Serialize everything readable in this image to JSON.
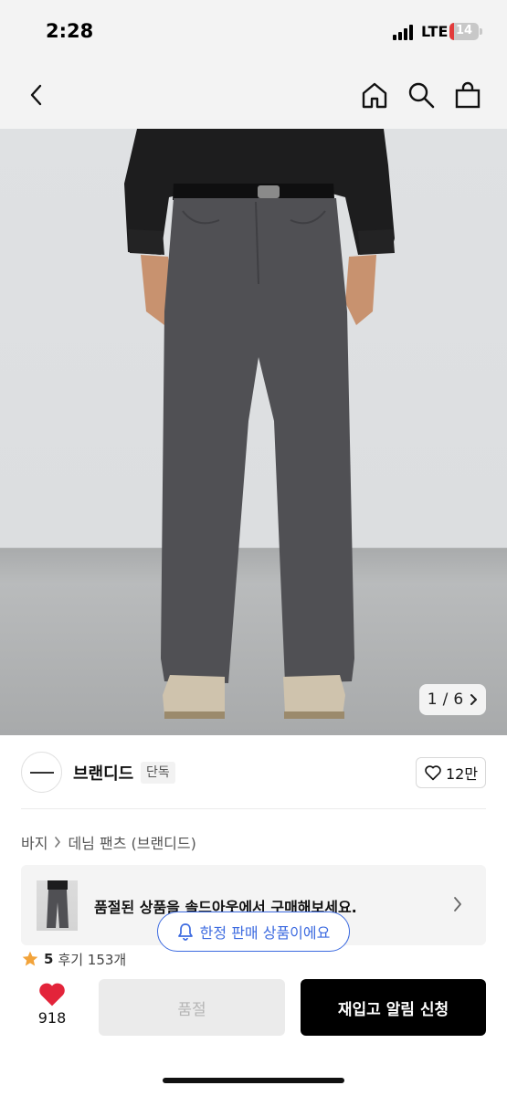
{
  "status_bar": {
    "time": "2:28",
    "network": "LTE",
    "battery": "14",
    "battery_level": 0.14,
    "battery_color": "#e23b3b"
  },
  "nav": {
    "back_icon": "chevron-left-icon",
    "home_icon": "home-icon",
    "search_icon": "search-icon",
    "bag_icon": "shopping-bag-icon"
  },
  "gallery": {
    "counter_current": "1",
    "counter_separator": "/",
    "counter_total": "6"
  },
  "brand": {
    "name": "브랜디드",
    "badge": "단독",
    "like_count": "12만"
  },
  "breadcrumb": {
    "category": "바지",
    "product": "데님 팬츠 (브랜디드)"
  },
  "banner": {
    "text": "품절된 상품을 솔드아웃에서 구매해보세요."
  },
  "limited": {
    "label": "한정 판매 상품이에요"
  },
  "rating": {
    "score": "5",
    "reviews": "후기 153개"
  },
  "bottom": {
    "wish_count": "918",
    "soldout_label": "품절",
    "restock_label": "재입고 알림 신청"
  },
  "colors": {
    "accent_blue": "#3d6be0",
    "heart_red": "#e3243a",
    "star_orange": "#f2a33a"
  }
}
